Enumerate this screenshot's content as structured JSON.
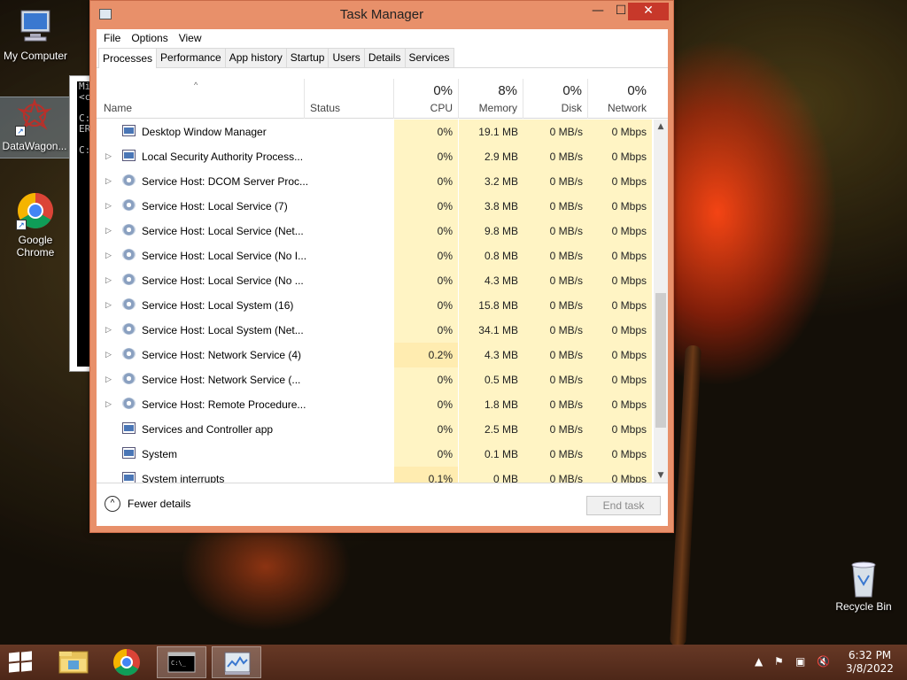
{
  "desktop": {
    "icons": [
      {
        "label": "My Computer"
      },
      {
        "label": "DataWagon..."
      },
      {
        "label": "Google Chrome"
      },
      {
        "label": "Recycle Bin"
      }
    ]
  },
  "cmd_window": {
    "text": "Mi\n<c\n\nC:\nER\n\nC:"
  },
  "task_manager": {
    "title": "Task Manager",
    "window_buttons": {
      "minimize": "—",
      "maximize": "☐",
      "close": "✕"
    },
    "menu": [
      "File",
      "Options",
      "View"
    ],
    "tabs": [
      "Processes",
      "Performance",
      "App history",
      "Startup",
      "Users",
      "Details",
      "Services"
    ],
    "active_tab": "Processes",
    "columns": {
      "name": "Name",
      "status": "Status",
      "cpu": {
        "label": "CPU",
        "pct": "0%"
      },
      "memory": {
        "label": "Memory",
        "pct": "8%"
      },
      "disk": {
        "label": "Disk",
        "pct": "0%"
      },
      "network": {
        "label": "Network",
        "pct": "0%"
      }
    },
    "rows": [
      {
        "expand": false,
        "icon": "window-icon",
        "name": "Desktop Window Manager",
        "cpu": "0%",
        "mem": "19.1 MB",
        "disk": "0 MB/s",
        "net": "0 Mbps"
      },
      {
        "expand": true,
        "icon": "window-icon",
        "name": "Local Security Authority Process...",
        "cpu": "0%",
        "mem": "2.9 MB",
        "disk": "0 MB/s",
        "net": "0 Mbps"
      },
      {
        "expand": true,
        "icon": "gear-icon",
        "name": "Service Host: DCOM Server Proc...",
        "cpu": "0%",
        "mem": "3.2 MB",
        "disk": "0 MB/s",
        "net": "0 Mbps"
      },
      {
        "expand": true,
        "icon": "gear-icon",
        "name": "Service Host: Local Service (7)",
        "cpu": "0%",
        "mem": "3.8 MB",
        "disk": "0 MB/s",
        "net": "0 Mbps"
      },
      {
        "expand": true,
        "icon": "gear-icon",
        "name": "Service Host: Local Service (Net...",
        "cpu": "0%",
        "mem": "9.8 MB",
        "disk": "0 MB/s",
        "net": "0 Mbps"
      },
      {
        "expand": true,
        "icon": "gear-icon",
        "name": "Service Host: Local Service (No I...",
        "cpu": "0%",
        "mem": "0.8 MB",
        "disk": "0 MB/s",
        "net": "0 Mbps"
      },
      {
        "expand": true,
        "icon": "gear-icon",
        "name": "Service Host: Local Service (No ...",
        "cpu": "0%",
        "mem": "4.3 MB",
        "disk": "0 MB/s",
        "net": "0 Mbps"
      },
      {
        "expand": true,
        "icon": "gear-icon",
        "name": "Service Host: Local System (16)",
        "cpu": "0%",
        "mem": "15.8 MB",
        "disk": "0 MB/s",
        "net": "0 Mbps"
      },
      {
        "expand": true,
        "icon": "gear-icon",
        "name": "Service Host: Local System (Net...",
        "cpu": "0%",
        "mem": "34.1 MB",
        "disk": "0 MB/s",
        "net": "0 Mbps"
      },
      {
        "expand": true,
        "icon": "gear-icon",
        "name": "Service Host: Network Service (4)",
        "cpu": "0.2%",
        "mem": "4.3 MB",
        "disk": "0 MB/s",
        "net": "0 Mbps"
      },
      {
        "expand": true,
        "icon": "gear-icon",
        "name": "Service Host: Network Service (...",
        "cpu": "0%",
        "mem": "0.5 MB",
        "disk": "0 MB/s",
        "net": "0 Mbps"
      },
      {
        "expand": true,
        "icon": "gear-icon",
        "name": "Service Host: Remote Procedure...",
        "cpu": "0%",
        "mem": "1.8 MB",
        "disk": "0 MB/s",
        "net": "0 Mbps"
      },
      {
        "expand": false,
        "icon": "window-icon",
        "name": "Services and Controller app",
        "cpu": "0%",
        "mem": "2.5 MB",
        "disk": "0 MB/s",
        "net": "0 Mbps"
      },
      {
        "expand": false,
        "icon": "window-icon",
        "name": "System",
        "cpu": "0%",
        "mem": "0.1 MB",
        "disk": "0 MB/s",
        "net": "0 Mbps"
      },
      {
        "expand": false,
        "icon": "window-icon",
        "name": "System interrupts",
        "cpu": "0.1%",
        "mem": "0 MB",
        "disk": "0 MB/s",
        "net": "0 Mbps"
      }
    ],
    "footer": {
      "fewer_details": "Fewer details",
      "end_task": "End task"
    }
  },
  "taskbar": {
    "items": [
      "start-button",
      "file-explorer-icon",
      "chrome-icon",
      "command-prompt-icon",
      "task-manager-icon"
    ],
    "clock": {
      "time": "6:32 PM",
      "date": "3/8/2022"
    }
  }
}
